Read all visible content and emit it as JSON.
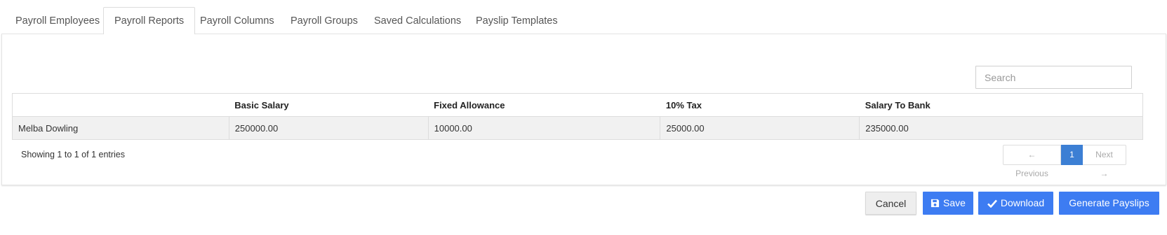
{
  "tabs": [
    {
      "label": "Payroll Employees",
      "active": false
    },
    {
      "label": "Payroll Reports",
      "active": true
    },
    {
      "label": "Payroll Columns",
      "active": false
    },
    {
      "label": "Payroll Groups",
      "active": false
    },
    {
      "label": "Saved Calculations",
      "active": false
    },
    {
      "label": "Payslip Templates",
      "active": false
    }
  ],
  "search": {
    "placeholder": "Search",
    "value": ""
  },
  "table": {
    "columns": [
      "",
      "Basic Salary",
      "Fixed Allowance",
      "10% Tax",
      "Salary To Bank"
    ],
    "rows": [
      [
        "Melba Dowling",
        "250000.00",
        "10000.00",
        "25000.00",
        "235000.00"
      ]
    ]
  },
  "info": "Showing 1 to 1 of 1 entries",
  "pagination": {
    "previous": "← Previous",
    "current": "1",
    "next": "Next →"
  },
  "buttons": {
    "cancel": "Cancel",
    "save": "Save",
    "save_icon": "floppy-disk-icon",
    "download": "Download",
    "download_icon": "check-icon",
    "generate": "Generate Payslips"
  },
  "colors": {
    "primary": "#3d7cf2",
    "page_active": "#3c7fd4"
  }
}
